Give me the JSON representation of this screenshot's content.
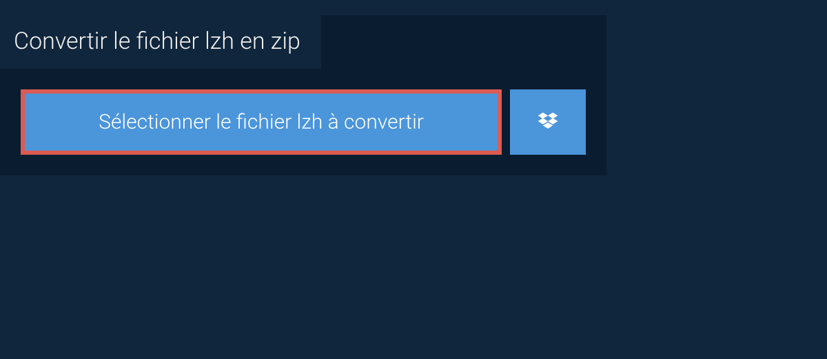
{
  "title": "Convertir le fichier lzh en zip",
  "selectButton": {
    "label": "Sélectionner le fichier lzh à convertir"
  },
  "colors": {
    "background": "#10263c",
    "panel": "#0a1d30",
    "buttonBg": "#4b95db",
    "buttonBorder": "#dd5b52",
    "text": "#ffffff"
  }
}
